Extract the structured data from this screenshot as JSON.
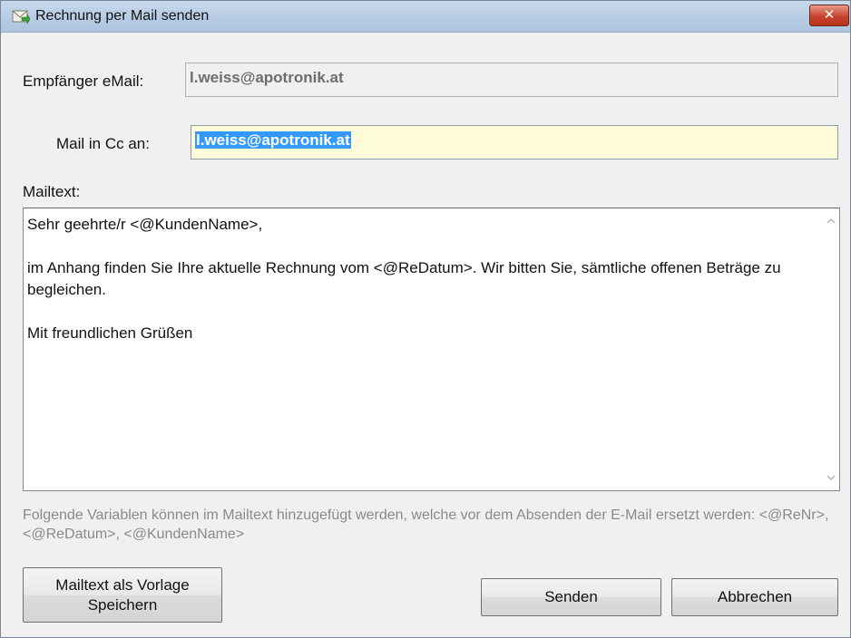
{
  "window": {
    "title": "Rechnung per Mail senden",
    "close_glyph": "✕",
    "icon": "mail-send-icon"
  },
  "form": {
    "to_label": "Empfänger eMail:",
    "to_value": "l.weiss@apotronik.at",
    "cc_label": "Mail in Cc an:",
    "cc_value": "l.weiss@apotronik.at",
    "mailtext_label": "Mailtext:"
  },
  "mailtext": {
    "line1": "Sehr geehrte/r <@KundenName>,",
    "line2": "im Anhang finden Sie Ihre aktuelle Rechnung vom <@ReDatum>. Wir bitten Sie, sämtliche offenen Beträge zu begleichen.",
    "line3": "Mit freundlichen Grüßen"
  },
  "hint": {
    "text": "Folgende Variablen können im Mailtext hinzugefügt werden, welche vor dem Absenden der E-Mail ersetzt werden: <@ReNr>, <@ReDatum>, <@KundenName>"
  },
  "buttons": {
    "save_template_line1": "Mailtext als Vorlage",
    "save_template_line2": "Speichern",
    "send": "Senden",
    "cancel": "Abbrechen"
  },
  "colors": {
    "title_bar": "#b9cde5",
    "close_button": "#c7432d",
    "cc_field_bg": "#fdfbd8",
    "selection": "#3399ff"
  }
}
